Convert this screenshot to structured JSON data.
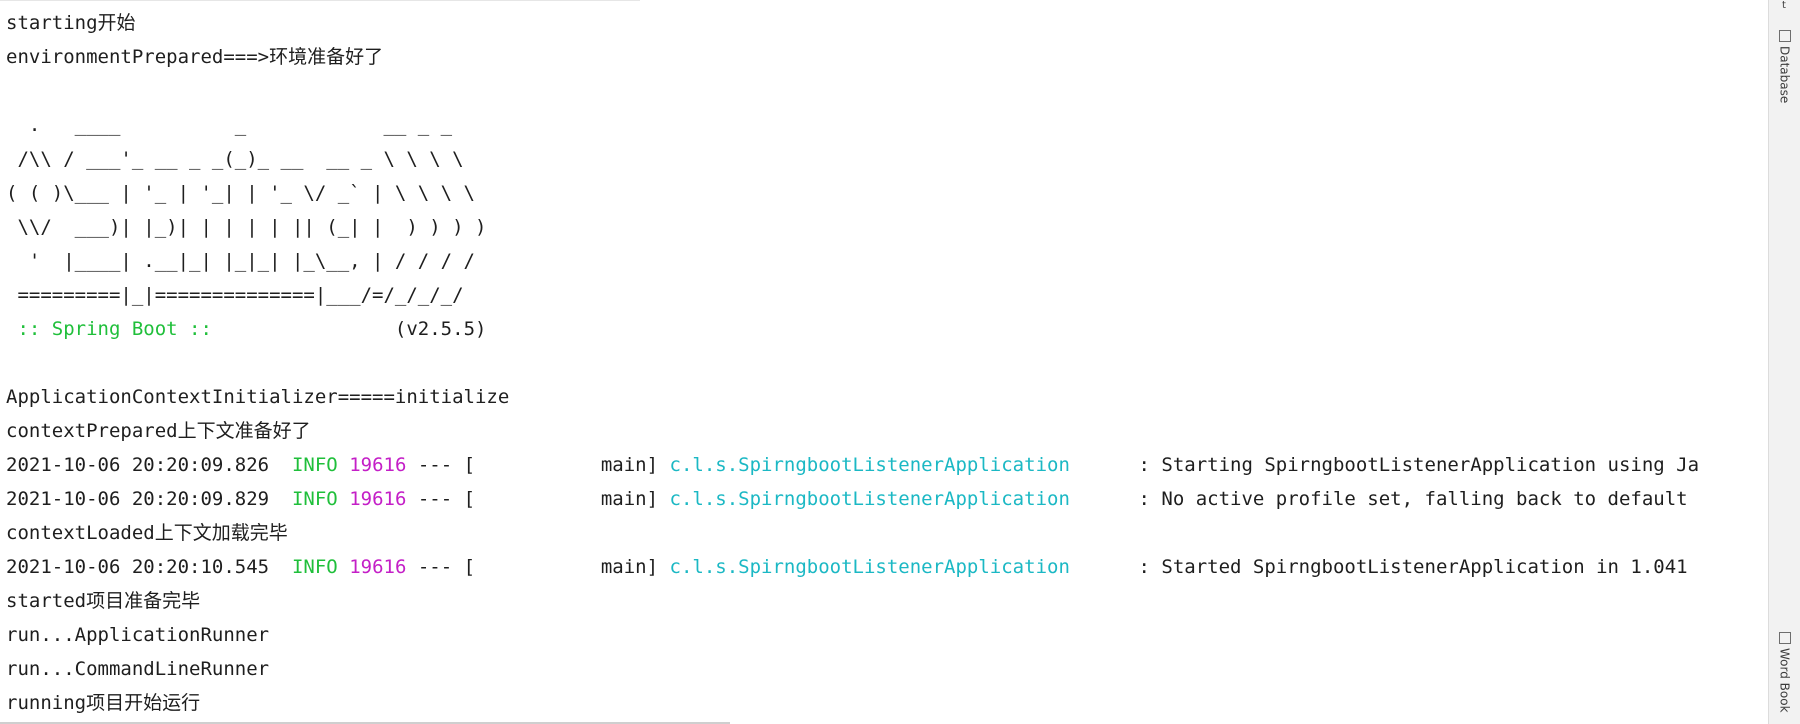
{
  "console": {
    "lines": [
      [
        {
          "t": "starting开始"
        }
      ],
      [
        {
          "t": "environmentPrepared===>环境准备好了"
        }
      ],
      [
        {
          "t": ""
        }
      ],
      [
        {
          "t": "  .   ____          _            __ _ _"
        }
      ],
      [
        {
          "t": " /\\\\ / ___'_ __ _ _(_)_ __  __ _ \\ \\ \\ \\"
        }
      ],
      [
        {
          "t": "( ( )\\___ | '_ | '_| | '_ \\/ _` | \\ \\ \\ \\"
        }
      ],
      [
        {
          "t": " \\\\/  ___)| |_)| | | | | || (_| |  ) ) ) )"
        }
      ],
      [
        {
          "t": "  '  |____| .__|_| |_|_| |_\\__, | / / / /"
        }
      ],
      [
        {
          "t": " =========|_|==============|___/=/_/_/_/"
        }
      ],
      [
        {
          "t": " :: Spring Boot ::",
          "c": "green"
        },
        {
          "t": "                (v2.5.5)"
        }
      ],
      [
        {
          "t": ""
        }
      ],
      [
        {
          "t": "ApplicationContextInitializer=====initialize"
        }
      ],
      [
        {
          "t": "contextPrepared上下文准备好了"
        }
      ],
      [
        {
          "t": "2021-10-06 20:20:09.826  "
        },
        {
          "t": "INFO",
          "c": "green"
        },
        {
          "t": " "
        },
        {
          "t": "19616",
          "c": "magenta"
        },
        {
          "t": " --- [           main] "
        },
        {
          "t": "c.l.s.SpirngbootListenerApplication",
          "c": "cyan"
        },
        {
          "t": "      : Starting SpirngbootListenerApplication using Ja"
        }
      ],
      [
        {
          "t": "2021-10-06 20:20:09.829  "
        },
        {
          "t": "INFO",
          "c": "green"
        },
        {
          "t": " "
        },
        {
          "t": "19616",
          "c": "magenta"
        },
        {
          "t": " --- [           main] "
        },
        {
          "t": "c.l.s.SpirngbootListenerApplication",
          "c": "cyan"
        },
        {
          "t": "      : No active profile set, falling back to default"
        }
      ],
      [
        {
          "t": "contextLoaded上下文加载完毕"
        }
      ],
      [
        {
          "t": "2021-10-06 20:20:10.545  "
        },
        {
          "t": "INFO",
          "c": "green"
        },
        {
          "t": " "
        },
        {
          "t": "19616",
          "c": "magenta"
        },
        {
          "t": " --- [           main] "
        },
        {
          "t": "c.l.s.SpirngbootListenerApplication",
          "c": "cyan"
        },
        {
          "t": "      : Started SpirngbootListenerApplication in 1.041"
        }
      ],
      [
        {
          "t": "started项目准备完毕"
        }
      ],
      [
        {
          "t": "run...ApplicationRunner"
        }
      ],
      [
        {
          "t": "run...CommandLineRunner"
        }
      ],
      [
        {
          "t": "running项目开始运行"
        }
      ]
    ]
  },
  "right_panel": {
    "edge_mark": "t",
    "tabs": [
      {
        "label": "Database",
        "icon": "database-icon"
      },
      {
        "label": "Word Book",
        "icon": "word-book-icon"
      }
    ]
  },
  "colors": {
    "text": "#1e1e1e",
    "green": "#1fbf3a",
    "magenta": "#c41fc7",
    "cyan": "#1bb8c4"
  }
}
